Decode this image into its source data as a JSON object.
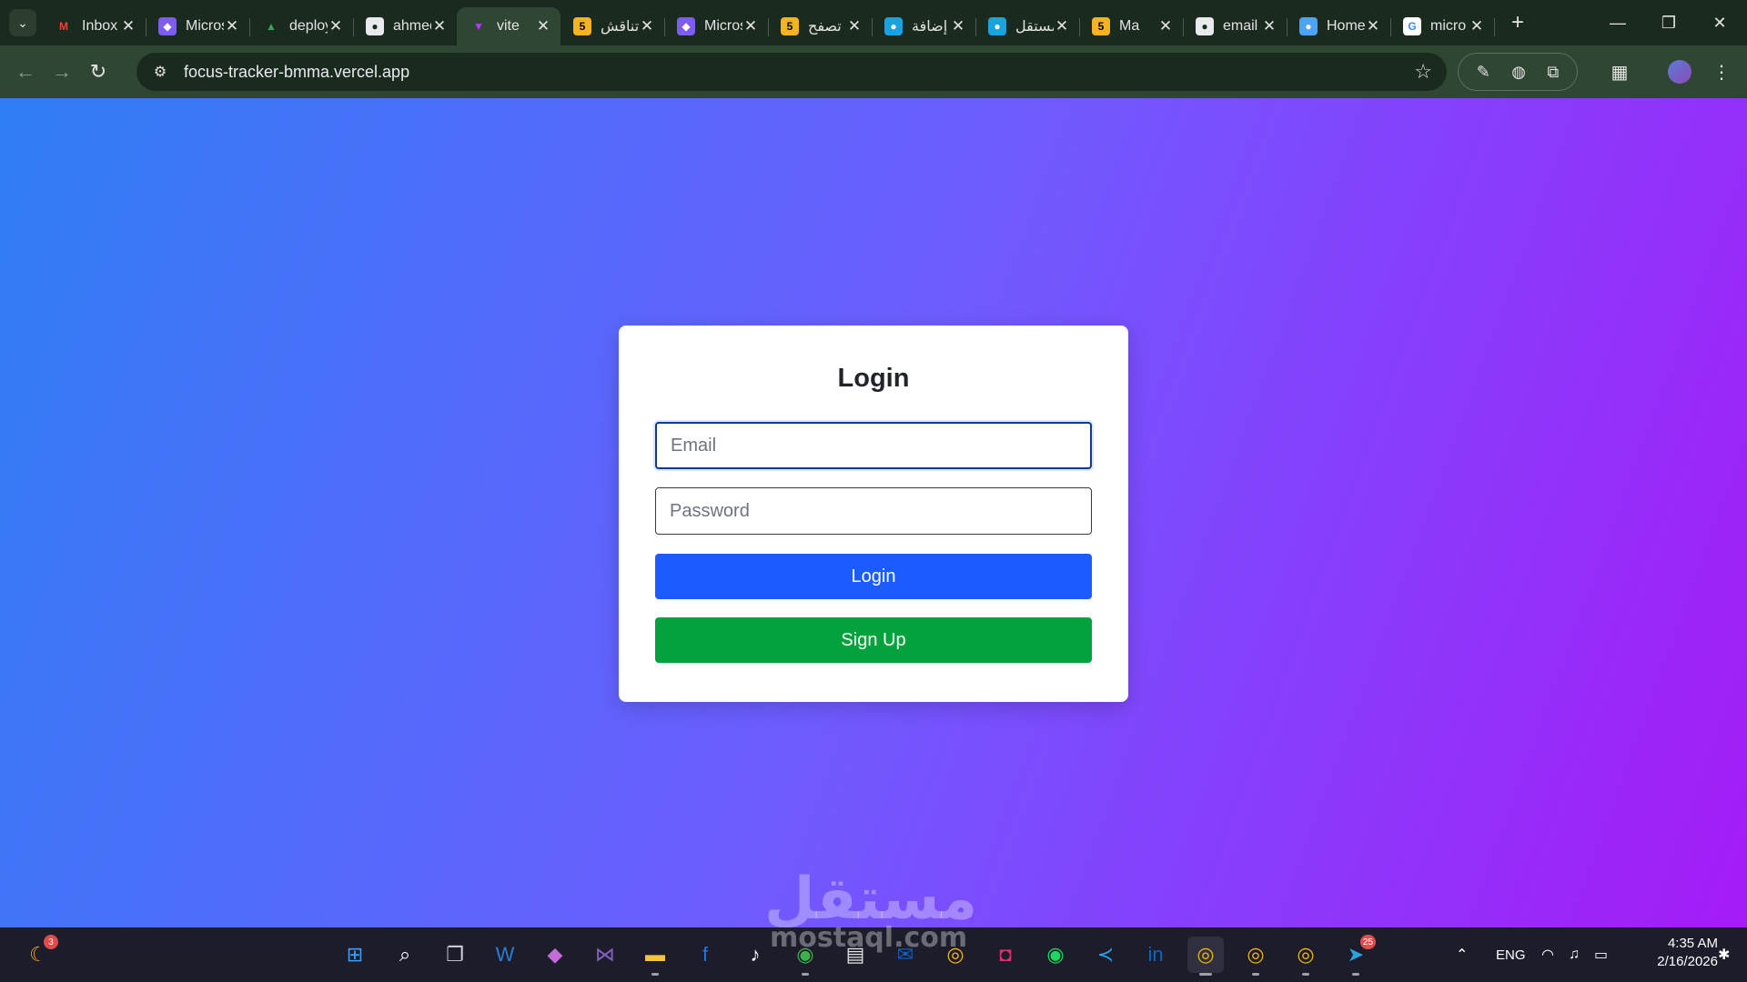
{
  "browser": {
    "tabs": [
      {
        "title": "Inbox",
        "icon": "gmail-icon",
        "fav_bg": "transparent",
        "fav_fg": "#ea4335",
        "glyph": "M"
      },
      {
        "title": "Microsoft",
        "icon": "copilot-icon",
        "fav_bg": "#7f5cf0",
        "fav_fg": "#fff",
        "glyph": "◆"
      },
      {
        "title": "deploy",
        "icon": "google-drive-icon",
        "fav_bg": "transparent",
        "fav_fg": "#34a853",
        "glyph": "▲"
      },
      {
        "title": "ahmed",
        "icon": "github-icon",
        "fav_bg": "#e8eaed",
        "fav_fg": "#1b2a1e",
        "glyph": "●"
      },
      {
        "title": "vite",
        "icon": "vite-icon",
        "fav_bg": "transparent",
        "fav_fg": "#bd34fe",
        "glyph": "▼",
        "active": true
      },
      {
        "title": "تناقش",
        "icon": "mostaql-icon",
        "fav_bg": "#f5b324",
        "fav_fg": "#000",
        "glyph": "5"
      },
      {
        "title": "Microsoft",
        "icon": "copilot-icon",
        "fav_bg": "#7f5cf0",
        "fav_fg": "#fff",
        "glyph": "◆"
      },
      {
        "title": "تصفح",
        "icon": "mostaql-icon",
        "fav_bg": "#f5b324",
        "fav_fg": "#000",
        "glyph": "5"
      },
      {
        "title": "إضافة",
        "icon": "circle-app-icon",
        "fav_bg": "#1aa1e0",
        "fav_fg": "#fff",
        "glyph": "●"
      },
      {
        "title": "مستقل",
        "icon": "circle-app-icon",
        "fav_bg": "#1aa1e0",
        "fav_fg": "#fff",
        "glyph": "●"
      },
      {
        "title": "Ma",
        "icon": "mostaql-icon",
        "fav_bg": "#f5b324",
        "fav_fg": "#000",
        "glyph": "5"
      },
      {
        "title": "email",
        "icon": "github-icon",
        "fav_bg": "#e8eaed",
        "fav_fg": "#1b2a1e",
        "glyph": "●"
      },
      {
        "title": "Home",
        "icon": "home-app-icon",
        "fav_bg": "#4fa3f7",
        "fav_fg": "#fff",
        "glyph": "●"
      },
      {
        "title": "micro",
        "icon": "google-icon",
        "fav_bg": "#fff",
        "fav_fg": "#4285f4",
        "glyph": "G"
      }
    ],
    "url": "focus-tracker-bmma.vercel.app"
  },
  "login": {
    "title": "Login",
    "email_placeholder": "Email",
    "password_placeholder": "Password",
    "login_label": "Login",
    "signup_label": "Sign Up"
  },
  "watermark": {
    "text": "مستقل",
    "sub": "mostaql.com"
  },
  "taskbar": {
    "weather_badge": "3",
    "telegram_badge": "25",
    "language": "ENG",
    "time": "4:35 AM",
    "date": "2/16/2026"
  },
  "colors": {
    "gradient_start": "#2f7ef5",
    "gradient_end": "#a51bf7",
    "login_button": "#1a5cff",
    "signup_button": "#04a23c"
  }
}
